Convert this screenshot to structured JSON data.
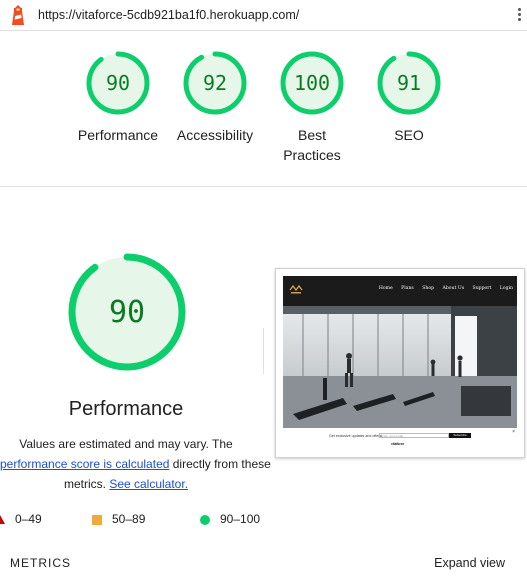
{
  "header": {
    "url": "https://vitaforce-5cdb921ba1f0.herokuapp.com/",
    "logo_icon": "lighthouse-icon",
    "menu_icon": "kebab-menu-icon"
  },
  "summary": {
    "categories": [
      {
        "label": "Performance",
        "score": "90"
      },
      {
        "label": "Accessibility",
        "score": "92"
      },
      {
        "label": "Best Practices",
        "score": "100"
      },
      {
        "label": "SEO",
        "score": "91"
      }
    ]
  },
  "performance": {
    "score": "90",
    "title": "Performance",
    "desc_line1": "Values are estimated and may vary. The",
    "desc_link1": "performance score is calculated",
    "desc_line2_rest": " directly from these",
    "desc_line3_pre": "metrics. ",
    "desc_link2": "See calculator."
  },
  "screenshot": {
    "nav_links": [
      "Home",
      "Plans",
      "Shop",
      "About Us",
      "Support",
      "Login"
    ],
    "newsletter_label": "Get exclusive updates and offers!",
    "newsletter_placeholder": "Enter your email",
    "newsletter_button": "Subscribe",
    "newsletter_logo": "vitaforce"
  },
  "legend": [
    {
      "range": "0–49",
      "shape": "triangle",
      "color": "#cc0000"
    },
    {
      "range": "50–89",
      "shape": "square",
      "color": "#f0a93b"
    },
    {
      "range": "90–100",
      "shape": "circle",
      "color": "#0cce6b"
    }
  ],
  "footer": {
    "metrics_label": "METRICS",
    "expand_label": "Expand view"
  },
  "colors": {
    "pass_arc": "#0cce6b",
    "pass_text": "#0c7a23",
    "pass_fill": "#e6f7ea"
  }
}
